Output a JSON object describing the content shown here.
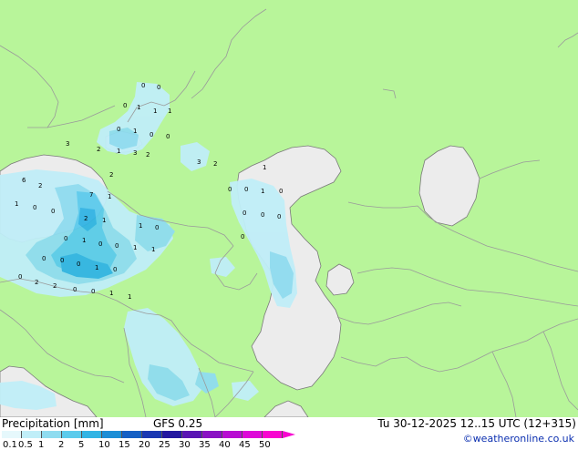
{
  "footer": {
    "title": "Precipitation [mm]",
    "model": "GFS 0.25",
    "valid_time": "Tu 30-12-2025 12..15 UTC (12+315)",
    "credit": "©weatheronline.co.uk"
  },
  "legend": {
    "labels": [
      "0.1",
      "0.5",
      "1",
      "2",
      "5",
      "10",
      "15",
      "20",
      "25",
      "30",
      "35",
      "40",
      "45",
      "50"
    ],
    "colors": [
      "#e6f8fc",
      "#c0eef8",
      "#8fdcf0",
      "#5ccbec",
      "#32b4e4",
      "#1c8ed6",
      "#1560c4",
      "#1a38b2",
      "#2418a0",
      "#5a16b4",
      "#8a12c4",
      "#b80ed2",
      "#de0ad8",
      "#f806d0"
    ]
  },
  "map_colors": {
    "land": "#b8f59a",
    "water": "#ececec",
    "border": "#9a9a9a",
    "coast": "#7a7a7a"
  },
  "point_values": [
    "0",
    "0",
    "0",
    "1",
    "1",
    "1",
    "0",
    "1",
    "0",
    "0",
    "3",
    "2",
    "1",
    "3",
    "2",
    "3",
    "2",
    "1",
    "2",
    "6",
    "2",
    "7",
    "1",
    "1",
    "0",
    "0",
    "2",
    "1",
    "1",
    "0",
    "0",
    "1",
    "0",
    "0",
    "1",
    "1",
    "0",
    "0",
    "0",
    "1",
    "0",
    "0",
    "2",
    "2",
    "0",
    "0",
    "1",
    "1",
    "0",
    "0",
    "1",
    "0",
    "0",
    "0",
    "0",
    "0"
  ]
}
